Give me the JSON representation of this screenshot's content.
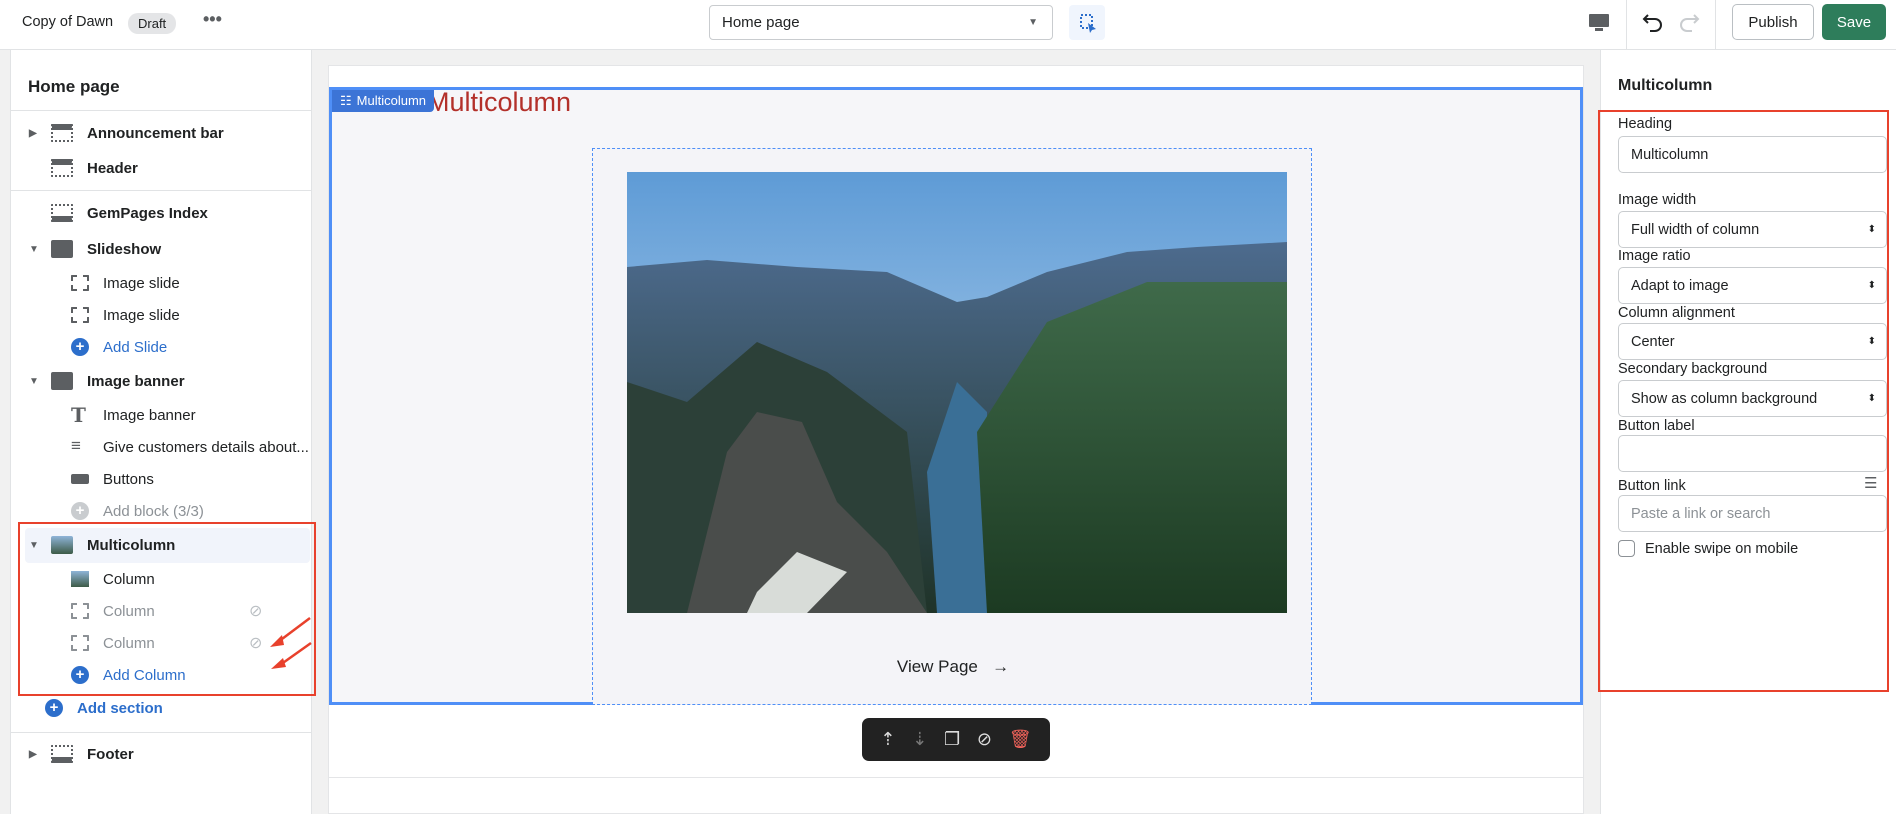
{
  "topbar": {
    "theme_name": "Copy of Dawn",
    "status_badge": "Draft",
    "page_select": "Home page",
    "publish": "Publish",
    "save": "Save"
  },
  "sidebar": {
    "title": "Home page",
    "items": [
      {
        "label": "Announcement bar"
      },
      {
        "label": "Header"
      },
      {
        "label": "GemPages Index"
      },
      {
        "label": "Slideshow"
      },
      {
        "label": "Image slide"
      },
      {
        "label": "Image slide"
      },
      {
        "label": "Add Slide"
      },
      {
        "label": "Image banner"
      },
      {
        "label": "Image banner"
      },
      {
        "label": "Give customers details about..."
      },
      {
        "label": "Buttons"
      },
      {
        "label": "Add block (3/3)"
      },
      {
        "label": "Multicolumn"
      },
      {
        "label": "Column"
      },
      {
        "label": "Column"
      },
      {
        "label": "Column"
      },
      {
        "label": "Add Column"
      },
      {
        "label": "Add section"
      },
      {
        "label": "Footer"
      }
    ]
  },
  "canvas": {
    "selection_tag": "Multicolumn",
    "heading": "Multicolumn",
    "view_page": "View Page",
    "arrow": "→"
  },
  "settings": {
    "title": "Multicolumn",
    "heading_label": "Heading",
    "heading_value": "Multicolumn",
    "image_width_label": "Image width",
    "image_width_value": "Full width of column",
    "image_ratio_label": "Image ratio",
    "image_ratio_value": "Adapt to image",
    "column_alignment_label": "Column alignment",
    "column_alignment_value": "Center",
    "secondary_bg_label": "Secondary background",
    "secondary_bg_value": "Show as column background",
    "button_label_label": "Button label",
    "button_label_value": "",
    "button_link_label": "Button link",
    "button_link_placeholder": "Paste a link or search",
    "swipe_label": "Enable swipe on mobile"
  },
  "colors": {
    "accent": "#2c6ecb",
    "save": "#2e7d5b",
    "annotation": "#e8412c",
    "selection": "#4f8ff7"
  }
}
